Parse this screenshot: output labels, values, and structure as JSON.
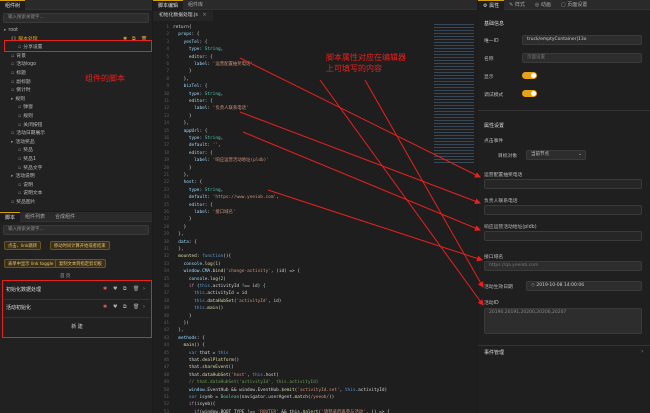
{
  "colors": {
    "accent": "#e8a21a",
    "annotation": "#e8201e",
    "background": "#1b1b1b"
  },
  "left_top": {
    "tab": "组件树",
    "search_placeholder": "输入搜索关键字...",
    "tree": [
      {
        "label": "root",
        "indent": 0,
        "icon": "folder-icon"
      },
      {
        "label": "脚本处理",
        "indent": 1,
        "icon": "script-icon",
        "selected": true
      },
      {
        "label": "分享设置",
        "indent": 2,
        "icon": "component-icon"
      },
      {
        "label": "背景",
        "indent": 1,
        "icon": "component-icon"
      },
      {
        "label": "活动logo",
        "indent": 1,
        "icon": "component-icon"
      },
      {
        "label": "标题",
        "indent": 1,
        "icon": "component-icon"
      },
      {
        "label": "副标题",
        "indent": 1,
        "icon": "component-icon"
      },
      {
        "label": "倒计时",
        "indent": 1,
        "icon": "component-icon"
      },
      {
        "label": "规则",
        "indent": 1,
        "icon": "folder-icon"
      },
      {
        "label": "弹窗",
        "indent": 2,
        "icon": "component-icon"
      },
      {
        "label": "规则",
        "indent": 2,
        "icon": "component-icon"
      },
      {
        "label": "关闭按钮",
        "indent": 2,
        "icon": "component-icon"
      },
      {
        "label": "活动日期展示",
        "indent": 1,
        "icon": "component-icon"
      },
      {
        "label": "活动奖品",
        "indent": 1,
        "icon": "folder-icon"
      },
      {
        "label": "奖品",
        "indent": 2,
        "icon": "component-icon"
      },
      {
        "label": "奖品1",
        "indent": 2,
        "icon": "component-icon"
      },
      {
        "label": "奖品文字",
        "indent": 2,
        "icon": "component-icon"
      },
      {
        "label": "活动说明",
        "indent": 1,
        "icon": "folder-icon"
      },
      {
        "label": "说明",
        "indent": 2,
        "icon": "component-icon"
      },
      {
        "label": "说明文本",
        "indent": 2,
        "icon": "component-icon"
      },
      {
        "label": "奖品图片",
        "indent": 1,
        "icon": "component-icon"
      }
    ],
    "annotation": "组件的脚本"
  },
  "left_bottom": {
    "tabs": [
      "脚本",
      "组件列表",
      "合成组件"
    ],
    "search_placeholder": "输入搜索关键字...",
    "chips": [
      "点击、link跳转",
      "移动时间计算开始或者结束",
      "表单中显示 link toggle",
      "复制文本到指定剪切板"
    ],
    "footer": "首 页",
    "scripts": [
      {
        "label": "初始化数据处理"
      },
      {
        "label": "活动初始化"
      }
    ],
    "add_button": "新 建"
  },
  "editor": {
    "tabs": [
      "脚本编辑",
      "组件库"
    ],
    "file_tab": "初始化数据处理.js",
    "annotation_line1": "脚本属性对应在编辑器",
    "annotation_line2": "上可填写的内容"
  },
  "right": {
    "tabs": [
      "属性",
      "样式",
      "动画",
      "页面设置"
    ],
    "basic_title": "基础信息",
    "id_label": "唯一ID",
    "id_value": "truck/emptyContainer|13o",
    "name_label": "名称",
    "name_placeholder": "页面设置",
    "show_label": "显示",
    "debug_label": "调试模式",
    "props_title": "属性设置",
    "event_label": "点击事件",
    "target_label": "目标对象",
    "target_value": "当前节点",
    "field1_label": "运营配置抽奖电话",
    "field2_label": "负责人联系电话",
    "field3_label": "响应运营活动地址(pldb)",
    "field4_label": "接口域名",
    "field4_placeholder": "https://qa.yeeiob.com",
    "field5_label": "活动生效日期",
    "field5_value": "2019-10-08 14:00:06",
    "field6_label": "活动ID",
    "field6_value": "20190.20191,20200,20206,20207",
    "event_title": "事件管理"
  }
}
